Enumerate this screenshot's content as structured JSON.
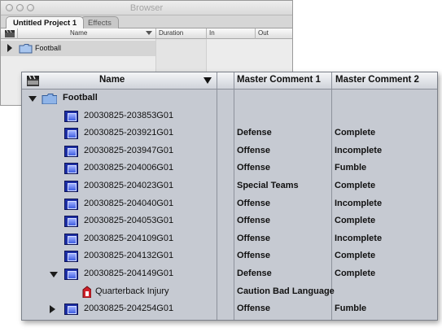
{
  "browser_window": {
    "title": "Browser",
    "tabs": [
      {
        "label": "Untitled Project 1",
        "active": true
      },
      {
        "label": "Effects",
        "active": false
      }
    ],
    "columns": [
      "Name",
      "Duration",
      "In",
      "Out"
    ],
    "rows": [
      {
        "label": "Football",
        "type": "bin",
        "expanded": false
      }
    ]
  },
  "list_view": {
    "columns": {
      "name": "Name",
      "master_comment_1": "Master Comment 1",
      "master_comment_2": "Master Comment 2"
    },
    "rows": [
      {
        "name": "Football",
        "type": "bin",
        "disclosure": "expanded",
        "indent": 0,
        "comment1": "",
        "comment2": ""
      },
      {
        "name": "20030825-203853G01",
        "type": "clip",
        "disclosure": "none",
        "indent": 1,
        "comment1": "",
        "comment2": ""
      },
      {
        "name": "20030825-203921G01",
        "type": "clip",
        "disclosure": "none",
        "indent": 1,
        "comment1": "Defense",
        "comment2": "Complete"
      },
      {
        "name": "20030825-203947G01",
        "type": "clip",
        "disclosure": "none",
        "indent": 1,
        "comment1": "Offense",
        "comment2": "Incomplete"
      },
      {
        "name": "20030825-204006G01",
        "type": "clip",
        "disclosure": "none",
        "indent": 1,
        "comment1": "Offense",
        "comment2": "Fumble"
      },
      {
        "name": "20030825-204023G01",
        "type": "clip",
        "disclosure": "none",
        "indent": 1,
        "comment1": "Special Teams",
        "comment2": "Complete"
      },
      {
        "name": "20030825-204040G01",
        "type": "clip",
        "disclosure": "none",
        "indent": 1,
        "comment1": "Offense",
        "comment2": "Incomplete"
      },
      {
        "name": "20030825-204053G01",
        "type": "clip",
        "disclosure": "none",
        "indent": 1,
        "comment1": "Offense",
        "comment2": "Complete"
      },
      {
        "name": "20030825-204109G01",
        "type": "clip",
        "disclosure": "none",
        "indent": 1,
        "comment1": "Offense",
        "comment2": "Incomplete"
      },
      {
        "name": "20030825-204132G01",
        "type": "clip",
        "disclosure": "none",
        "indent": 1,
        "comment1": "Offense",
        "comment2": "Complete"
      },
      {
        "name": "20030825-204149G01",
        "type": "clip",
        "disclosure": "expanded",
        "indent": 1,
        "comment1": "Defense",
        "comment2": "Complete"
      },
      {
        "name": "Quarterback Injury",
        "type": "marker",
        "disclosure": "none",
        "indent": 2,
        "comment1": "Caution Bad Language",
        "comment2": ""
      },
      {
        "name": "20030825-204254G01",
        "type": "clip",
        "disclosure": "collapsed",
        "indent": 1,
        "comment1": "Offense",
        "comment2": "Fumble"
      }
    ]
  },
  "colors": {
    "list_background": "#c6cad2",
    "clip_icon": "#1d2fa6",
    "marker_icon": "#d0202a",
    "folder_icon": "#8fb4e8"
  }
}
